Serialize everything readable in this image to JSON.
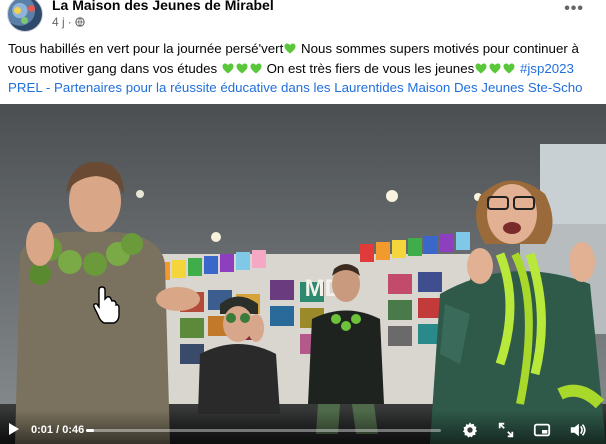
{
  "post": {
    "page_name": "La Maison des Jeunes de Mirabel",
    "time_ago": "4 j",
    "separator": "·",
    "more_label": "•••",
    "text_parts": [
      "Tous habillés en vert pour la journée persé'vert",
      " Nous sommes supers motivés pour continuer à vous motiver gang dans vos études ",
      " On est très fiers de vous les jeunes",
      " ",
      "#jsp2023",
      " ",
      "PREL - Partenaires pour la réussite éducative dans les Laurentides",
      " ",
      "Maison Des Jeunes Ste-Scho"
    ]
  },
  "video": {
    "current_time": "0:01",
    "time_sep": " / ",
    "duration": "0:46",
    "progress": 0.022,
    "sign_letters": "MDJ"
  },
  "colors": {
    "link": "#216fdb",
    "heart": "#5ac73a"
  },
  "icons": [
    "globe-icon",
    "more-options-icon",
    "green-heart-icon",
    "play-icon",
    "settings-icon",
    "expand-icon",
    "miniplayer-icon",
    "volume-icon"
  ]
}
